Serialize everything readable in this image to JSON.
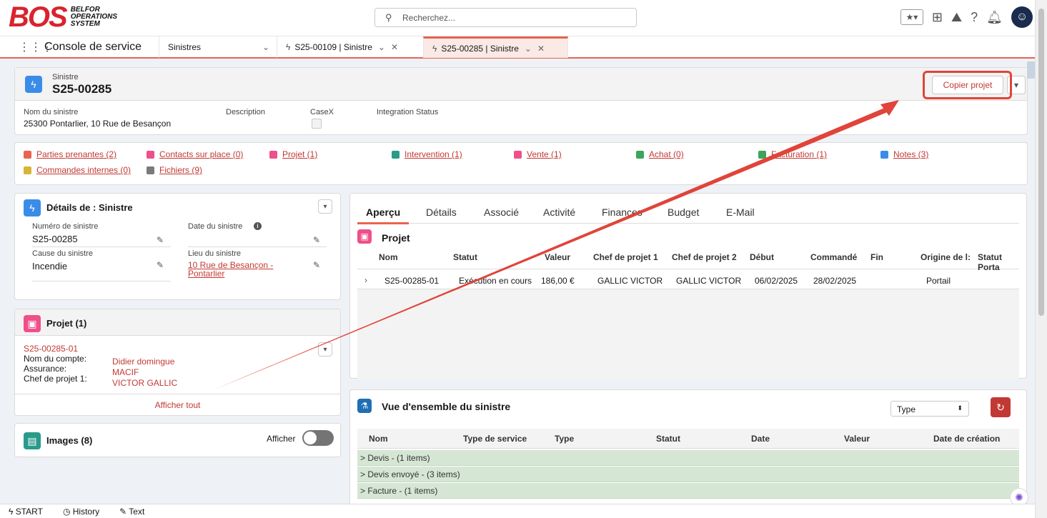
{
  "header": {
    "logo_big": "BOS",
    "logo_small": [
      "BELFOR",
      "OPERATIONS",
      "SYSTEM"
    ],
    "search_placeholder": "Recherchez...",
    "icons": [
      "star-icon",
      "add-icon",
      "trailhead-icon",
      "help-icon",
      "bell-icon",
      "avatar-icon"
    ]
  },
  "tabbar": {
    "app_name": "Console de service",
    "nav_object": "Sinistres",
    "tabs": [
      {
        "label": "S25-00109 | Sinistre"
      },
      {
        "label": "S25-00285 | Sinistre",
        "active": true
      }
    ]
  },
  "record": {
    "object_label": "Sinistre",
    "title": "S25-00285",
    "action_button": "Copier projet",
    "fields": [
      {
        "label": "Nom du sinistre",
        "value": "25300 Pontarlier, 10 Rue de Besançon"
      },
      {
        "label": "Description",
        "value": ""
      },
      {
        "label": "CaseX",
        "value": ""
      },
      {
        "label": "Integration Status",
        "value": ""
      }
    ]
  },
  "related_links": [
    {
      "label": "Parties prenantes (2)",
      "color": "#e8644e"
    },
    {
      "label": "Contacts sur place (0)",
      "color": "#ef4f8a"
    },
    {
      "label": "Projet (1)",
      "color": "#ef4f8a"
    },
    {
      "label": "Intervention (1)",
      "color": "#2a9a8a"
    },
    {
      "label": "Vente (1)",
      "color": "#ef4f8a"
    },
    {
      "label": "Achat (0)",
      "color": "#3ba55c"
    },
    {
      "label": "Facturation (1)",
      "color": "#3ba55c"
    },
    {
      "label": "Notes (3)",
      "color": "#3b8ce8"
    },
    {
      "label": "Commandes internes (0)",
      "color": "#d8b437"
    },
    {
      "label": "Fichiers (9)",
      "color": "#7a7a7a"
    }
  ],
  "details_card": {
    "title": "Détails de : Sinistre",
    "fields": [
      {
        "label": "Numéro de sinistre",
        "value": "S25-00285"
      },
      {
        "label": "Date du sinistre",
        "value": ""
      },
      {
        "label": "Cause du sinistre",
        "value": "Incendie"
      },
      {
        "label": "Lieu du sinistre",
        "value": "10 Rue de Besançon - Pontarlier"
      }
    ]
  },
  "projet_card": {
    "title": "Projet (1)",
    "record": "S25-00285-01",
    "rows": [
      {
        "label": "Nom du compte:",
        "value": "Didier domingue"
      },
      {
        "label": "Assurance:",
        "value": "MACIF"
      },
      {
        "label": "Chef de projet 1:",
        "value": "VICTOR GALLIC"
      }
    ],
    "view_all": "Afficher tout"
  },
  "images_card": {
    "title": "Images (8)",
    "toggle_label": "Afficher"
  },
  "main_tabs": [
    "Aperçu",
    "Détails",
    "Associé",
    "Activité",
    "Finances",
    "Budget",
    "E-Mail"
  ],
  "projet_table": {
    "title": "Projet",
    "columns": [
      "Nom",
      "Statut",
      "Valeur",
      "Chef de projet 1",
      "Chef de projet 2",
      "Début",
      "Commandé",
      "Fin",
      "Origine de l:",
      "Statut Porta"
    ],
    "row": [
      "S25-00285-01",
      "Exécution en cours",
      "186,00 €",
      "GALLIC VICTOR",
      "GALLIC VICTOR",
      "06/02/2025",
      "28/02/2025",
      "",
      "Portail",
      ""
    ]
  },
  "overview": {
    "title": "Vue d'ensemble du sinistre",
    "filter_value": "Type",
    "columns": [
      "Nom",
      "Type de service",
      "Type",
      "Statut",
      "Date",
      "Valeur",
      "Date de création"
    ],
    "groups": [
      "> Devis - (1 items)",
      "> Devis envoyé - (3 items)",
      "> Facture - (1 items)"
    ]
  },
  "footer": {
    "items": [
      "START",
      "History",
      "Text"
    ]
  },
  "colors": {
    "accent": "#e8644e",
    "link": "#c23934",
    "annotation": "#e0443a"
  }
}
